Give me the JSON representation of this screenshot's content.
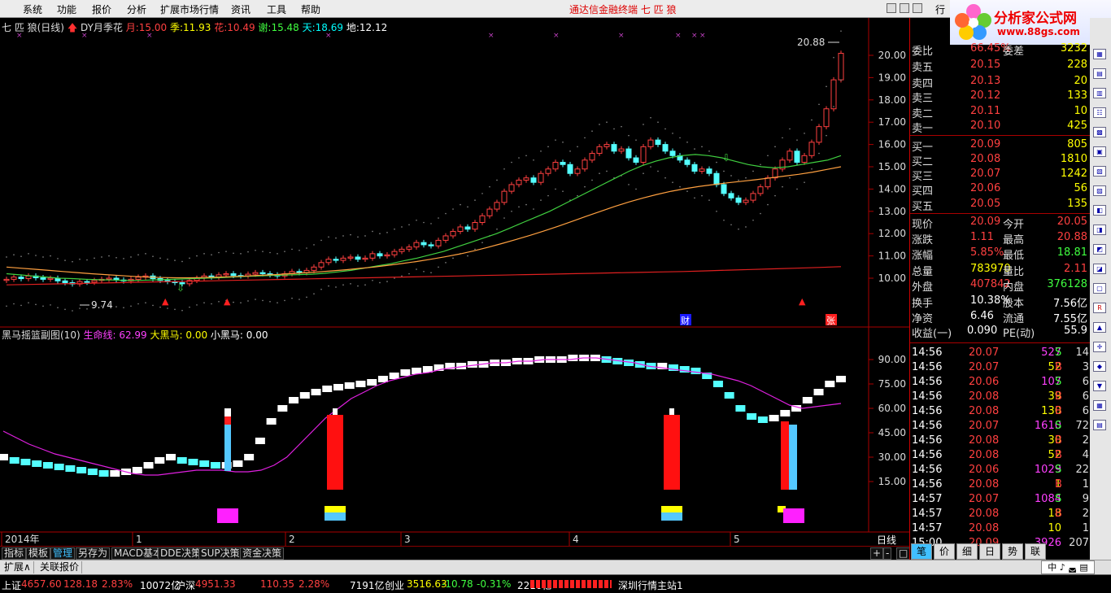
{
  "menu": {
    "items": [
      "系统",
      "功能",
      "报价",
      "分析",
      "扩展市场行情",
      "资讯",
      "工具",
      "帮助"
    ],
    "title": "通达信金融终端  七 匹 狼"
  },
  "logo": {
    "text": "分析家公式网",
    "url": "www.88gs.com",
    "corner": "行"
  },
  "main_header": {
    "name": "七 匹 狼(日线)",
    "indicator": "DY月季花",
    "fields": [
      {
        "label": "月:",
        "value": "15.00",
        "color": "#ff4040"
      },
      {
        "label": "季:",
        "value": "11.93",
        "color": "#ffff00"
      },
      {
        "label": "花:",
        "value": "10.49",
        "color": "#ff4040"
      },
      {
        "label": "谢:",
        "value": "15.48",
        "color": "#40ff40"
      },
      {
        "label": "天:",
        "value": "18.69",
        "color": "#00ffff"
      },
      {
        "label": "地:",
        "value": "12.12",
        "color": "#ffffff"
      }
    ]
  },
  "sub_header": {
    "name": "黑马摇篮副图(10)",
    "fields": [
      {
        "label": "生命线:",
        "value": "62.99",
        "color": "#ff40ff"
      },
      {
        "label": "大黑马:",
        "value": "0.00",
        "color": "#ffff00"
      },
      {
        "label": "小黑马:",
        "value": "0.00",
        "color": "#ffffff"
      }
    ]
  },
  "chart_data": {
    "type": "candlestick",
    "price_ticks": [
      "20.00",
      "19.00",
      "18.00",
      "17.00",
      "16.00",
      "15.00",
      "14.00",
      "13.00",
      "12.00",
      "11.00",
      "10.00"
    ],
    "sub_ticks": [
      "90.00",
      "75.00",
      "60.00",
      "45.00",
      "30.00",
      "15.00"
    ],
    "x_labels": [
      "2014年",
      "1",
      "2",
      "3",
      "4",
      "5"
    ],
    "high_label": "20.88",
    "low_label": "9.74",
    "markers": [
      "财",
      "张"
    ],
    "period_label": "日线",
    "closes": [
      9.95,
      10.05,
      9.98,
      10.1,
      10.02,
      9.95,
      10.0,
      9.88,
      9.8,
      9.74,
      9.85,
      9.82,
      9.9,
      9.95,
      10.0,
      9.92,
      9.88,
      9.95,
      10.05,
      10.1,
      9.98,
      9.9,
      9.85,
      9.8,
      9.75,
      9.9,
      10.0,
      10.1,
      10.05,
      10.15,
      10.2,
      10.12,
      10.1,
      10.18,
      10.25,
      10.2,
      10.15,
      10.1,
      10.2,
      10.3,
      10.25,
      10.35,
      10.5,
      10.7,
      10.85,
      10.8,
      10.9,
      10.95,
      10.85,
      10.9,
      11.1,
      11.0,
      11.05,
      11.2,
      11.3,
      11.4,
      11.6,
      11.5,
      11.45,
      11.7,
      11.9,
      12.1,
      12.3,
      12.2,
      12.5,
      12.8,
      13.1,
      13.4,
      13.9,
      14.2,
      14.4,
      14.5,
      14.3,
      14.7,
      14.9,
      15.2,
      15.1,
      14.7,
      14.9,
      15.3,
      15.6,
      15.9,
      16.0,
      15.7,
      15.8,
      15.4,
      15.2,
      15.9,
      16.2,
      16.0,
      15.7,
      15.5,
      15.3,
      15.1,
      14.8,
      14.9,
      14.7,
      14.2,
      13.8,
      13.6,
      13.4,
      13.5,
      13.8,
      14.1,
      14.5,
      14.9,
      15.3,
      15.7,
      15.2,
      15.5,
      16.1,
      16.8,
      17.6,
      18.9,
      20.09
    ],
    "ma_green": [
      10.2,
      10.15,
      10.1,
      10.05,
      10.0,
      9.98,
      9.95,
      9.93,
      9.92,
      9.9,
      9.9,
      9.92,
      9.94,
      9.96,
      9.98,
      10.0,
      10.02,
      10.05,
      10.08,
      10.1,
      10.12,
      10.14,
      10.16,
      10.18,
      10.22,
      10.28,
      10.35,
      10.45,
      10.55,
      10.65,
      10.78,
      10.9,
      11.05,
      11.2,
      11.4,
      11.6,
      11.8,
      12.0,
      12.25,
      12.5,
      12.75,
      13.0,
      13.3,
      13.6,
      13.9,
      14.2,
      14.5,
      14.8,
      15.05,
      15.25,
      15.4,
      15.5,
      15.55,
      15.5,
      15.4,
      15.25,
      15.1,
      15.0,
      14.95,
      15.0,
      15.1,
      15.2,
      15.3,
      15.5
    ],
    "ma_orange": [
      10.5,
      10.45,
      10.4,
      10.35,
      10.3,
      10.25,
      10.2,
      10.16,
      10.12,
      10.08,
      10.05,
      10.03,
      10.02,
      10.02,
      10.03,
      10.05,
      10.07,
      10.1,
      10.13,
      10.16,
      10.2,
      10.24,
      10.28,
      10.33,
      10.38,
      10.44,
      10.5,
      10.58,
      10.66,
      10.75,
      10.85,
      10.96,
      11.08,
      11.22,
      11.38,
      11.55,
      11.73,
      11.92,
      12.12,
      12.33,
      12.55,
      12.78,
      13.0,
      13.22,
      13.42,
      13.6,
      13.76,
      13.9,
      14.02,
      14.12,
      14.2,
      14.28,
      14.35,
      14.42,
      14.5,
      14.58,
      14.66,
      14.76,
      14.88,
      15.0
    ],
    "ma_red": [
      9.7,
      9.72,
      9.74,
      9.76,
      9.78,
      9.8,
      9.82,
      9.84,
      9.86,
      9.88,
      9.9,
      9.92,
      9.94,
      9.96,
      9.98,
      10.0,
      10.02,
      10.04,
      10.06,
      10.08,
      10.1,
      10.12,
      10.14,
      10.16,
      10.18,
      10.2,
      10.22,
      10.24,
      10.26,
      10.28,
      10.3,
      10.33,
      10.36,
      10.39,
      10.42,
      10.45,
      10.48,
      10.52
    ],
    "sub_white": [
      30,
      28,
      27,
      26,
      25,
      24,
      23,
      22,
      21,
      20,
      20,
      21,
      22,
      25,
      28,
      30,
      28,
      27,
      26,
      25,
      25,
      26,
      30,
      40,
      52,
      60,
      65,
      68,
      70,
      72,
      73,
      74,
      75,
      76,
      78,
      80,
      82,
      83,
      84,
      85,
      86,
      86,
      87,
      87,
      88,
      88,
      89,
      89,
      90,
      90,
      90,
      91,
      91,
      91,
      90,
      89,
      88,
      87,
      86,
      86,
      85,
      84,
      83,
      80,
      75,
      68,
      60,
      55,
      53,
      54,
      57,
      60,
      65,
      70,
      75,
      78
    ],
    "sub_magenta": [
      46,
      42,
      38,
      35,
      32,
      30,
      28,
      26,
      24,
      22,
      20,
      19,
      19,
      20,
      21,
      22,
      22,
      22,
      21,
      21,
      22,
      25,
      30,
      38,
      46,
      54,
      60,
      66,
      70,
      74,
      77,
      79,
      81,
      82,
      84,
      85,
      86,
      87,
      88,
      88,
      89,
      89,
      90,
      90,
      90,
      91,
      91,
      90,
      89,
      88,
      86,
      85,
      84,
      83,
      82,
      81,
      79,
      77,
      74,
      70,
      66,
      62,
      60,
      61,
      62,
      63
    ]
  },
  "side": {
    "rows": [
      {
        "l": "委比",
        "v": "66.45%",
        "vc": "#ff4040",
        "l2": "委差",
        "v2": "3232",
        "v2c": "#ffff00"
      },
      {
        "l": "卖五",
        "v": "20.15",
        "vc": "#ff4040",
        "l2": "",
        "v2": "228",
        "v2c": "#ffff00"
      },
      {
        "l": "卖四",
        "v": "20.13",
        "vc": "#ff4040",
        "l2": "",
        "v2": "20",
        "v2c": "#ffff00"
      },
      {
        "l": "卖三",
        "v": "20.12",
        "vc": "#ff4040",
        "l2": "",
        "v2": "133",
        "v2c": "#ffff00"
      },
      {
        "l": "卖二",
        "v": "20.11",
        "vc": "#ff4040",
        "l2": "",
        "v2": "10",
        "v2c": "#ffff00"
      },
      {
        "l": "卖一",
        "v": "20.10",
        "vc": "#ff4040",
        "l2": "",
        "v2": "425",
        "v2c": "#ffff00"
      },
      {
        "l": "买一",
        "v": "20.09",
        "vc": "#ff4040",
        "l2": "",
        "v2": "805",
        "v2c": "#ffff00"
      },
      {
        "l": "买二",
        "v": "20.08",
        "vc": "#ff4040",
        "l2": "",
        "v2": "1810",
        "v2c": "#ffff00"
      },
      {
        "l": "买三",
        "v": "20.07",
        "vc": "#ff4040",
        "l2": "",
        "v2": "1242",
        "v2c": "#ffff00"
      },
      {
        "l": "买四",
        "v": "20.06",
        "vc": "#ff4040",
        "l2": "",
        "v2": "56",
        "v2c": "#ffff00"
      },
      {
        "l": "买五",
        "v": "20.05",
        "vc": "#ff4040",
        "l2": "",
        "v2": "135",
        "v2c": "#ffff00"
      },
      {
        "l": "现价",
        "v": "20.09",
        "vc": "#ff4040",
        "l2": "今开",
        "v2": "20.05",
        "v2c": "#ff4040"
      },
      {
        "l": "涨跌",
        "v": "1.11",
        "vc": "#ff4040",
        "l2": "最高",
        "v2": "20.88",
        "v2c": "#ff4040"
      },
      {
        "l": "涨幅",
        "v": "5.85%",
        "vc": "#ff4040",
        "l2": "最低",
        "v2": "18.81",
        "v2c": "#40ff40"
      },
      {
        "l": "总量",
        "v": "783970",
        "vc": "#ffff00",
        "l2": "量比",
        "v2": "2.11",
        "v2c": "#ff4040"
      },
      {
        "l": "外盘",
        "v": "407842",
        "vc": "#ff4040",
        "l2": "内盘",
        "v2": "376128",
        "v2c": "#40ff40"
      },
      {
        "l": "换手",
        "v": "10.38%",
        "vc": "#ffffff",
        "l2": "股本",
        "v2": "7.56亿",
        "v2c": "#ffffff"
      },
      {
        "l": "净资",
        "v": "6.46",
        "vc": "#ffffff",
        "l2": "流通",
        "v2": "7.55亿",
        "v2c": "#ffffff"
      },
      {
        "l": "收益(一)",
        "v": "0.090",
        "vc": "#ffffff",
        "l2": "PE(动)",
        "v2": "55.9",
        "v2c": "#ffffff"
      }
    ],
    "trades": [
      {
        "t": "14:56",
        "p": "20.07",
        "v": "527",
        "s": "S",
        "n": "14"
      },
      {
        "t": "14:56",
        "p": "20.07",
        "v": "52",
        "s": "B",
        "n": "3"
      },
      {
        "t": "14:56",
        "p": "20.06",
        "v": "107",
        "s": "S",
        "n": "6"
      },
      {
        "t": "14:56",
        "p": "20.08",
        "v": "39",
        "s": "B",
        "n": "6"
      },
      {
        "t": "14:56",
        "p": "20.08",
        "v": "130",
        "s": "B",
        "n": "6"
      },
      {
        "t": "14:56",
        "p": "20.07",
        "v": "1610",
        "s": "S",
        "n": "72"
      },
      {
        "t": "14:56",
        "p": "20.08",
        "v": "30",
        "s": "B",
        "n": "2"
      },
      {
        "t": "14:56",
        "p": "20.08",
        "v": "52",
        "s": "B",
        "n": "4"
      },
      {
        "t": "14:56",
        "p": "20.06",
        "v": "1029",
        "s": "S",
        "n": "22"
      },
      {
        "t": "14:56",
        "p": "20.08",
        "v": "1",
        "s": "B",
        "n": "1"
      },
      {
        "t": "14:57",
        "p": "20.07",
        "v": "1084",
        "s": "S",
        "n": "9"
      },
      {
        "t": "14:57",
        "p": "20.08",
        "v": "18",
        "s": "B",
        "n": "2"
      },
      {
        "t": "14:57",
        "p": "20.08",
        "v": "10",
        "s": "",
        "n": "1"
      },
      {
        "t": "15:00",
        "p": "20.09",
        "v": "3926",
        "s": "",
        "n": "207"
      }
    ],
    "tabs": [
      "笔",
      "价",
      "细",
      "日",
      "势",
      "联"
    ]
  },
  "tabs1": [
    "指标",
    "模板",
    "管理",
    "另存为",
    "MACD基本",
    "DDE决策",
    "SUP决策",
    "资金决策"
  ],
  "tabs2": [
    "扩展∧",
    "关联报价"
  ],
  "status": [
    {
      "t": "上证",
      "c": "#ffffff"
    },
    {
      "t": "4657.60",
      "c": "#ff4040"
    },
    {
      "t": "128.18",
      "c": "#ff4040"
    },
    {
      "t": "2.83%",
      "c": "#ff4040"
    },
    {
      "t": "10072亿",
      "c": "#ffffff"
    },
    {
      "t": "沪深",
      "c": "#ffffff"
    },
    {
      "t": "4951.33",
      "c": "#ff4040"
    },
    {
      "t": "110.35",
      "c": "#ff4040"
    },
    {
      "t": "2.28%",
      "c": "#ff4040"
    },
    {
      "t": "7191亿",
      "c": "#ffffff"
    },
    {
      "t": "创业",
      "c": "#ffffff"
    },
    {
      "t": "3516.63",
      "c": "#ffff00"
    },
    {
      "t": "-10.78",
      "c": "#40ff40"
    },
    {
      "t": "-0.31%",
      "c": "#40ff40"
    },
    {
      "t": "2210亿",
      "c": "#ffffff"
    },
    {
      "t": "深圳行情主站1",
      "c": "#ffffff"
    }
  ],
  "ime": "中 ♪ ◛ ▤",
  "period_controls": [
    "+",
    "-",
    "□"
  ]
}
